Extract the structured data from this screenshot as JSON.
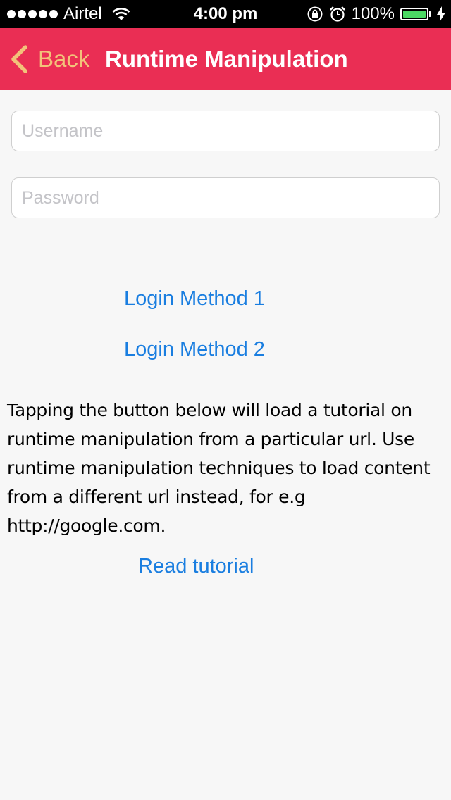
{
  "status_bar": {
    "carrier": "Airtel",
    "time": "4:00 pm",
    "battery_percent": "100%",
    "battery_level": 1.0,
    "icons": [
      "signal-dots-icon",
      "wifi-icon",
      "rotation-lock-icon",
      "alarm-icon",
      "battery-icon",
      "charging-bolt-icon"
    ]
  },
  "nav": {
    "back_label": "Back",
    "title": "Runtime Manipulation",
    "colors": {
      "background": "#ea2e54",
      "back": "#f2c27a",
      "title": "#ffffff"
    }
  },
  "form": {
    "username_placeholder": "Username",
    "username_value": "",
    "password_placeholder": "Password",
    "password_value": ""
  },
  "buttons": {
    "login_method_1": "Login Method 1",
    "login_method_2": "Login Method 2",
    "read_tutorial": "Read tutorial",
    "link_color": "#1a7ee0"
  },
  "description": "Tapping the button below will load a tutorial on runtime manipulation from a particular url. Use runtime manipulation techniques to load content from a different url instead, for e.g http://google.com."
}
